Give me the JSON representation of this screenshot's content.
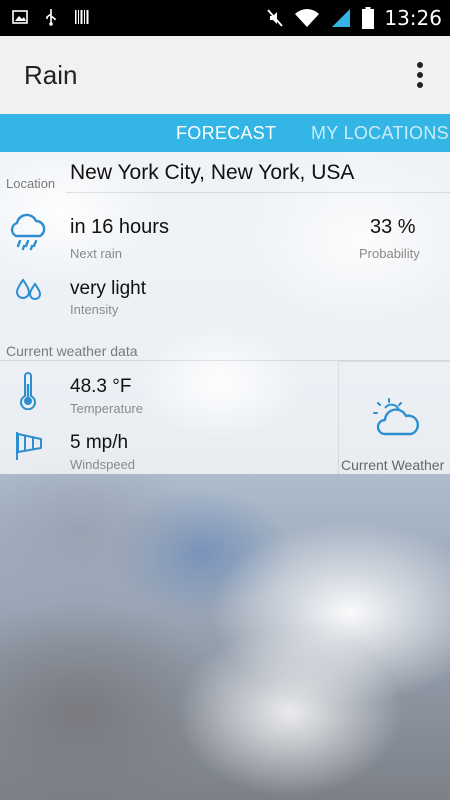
{
  "status_bar": {
    "time": "13:26",
    "icons": [
      "image-icon",
      "usb-icon",
      "barcode-icon",
      "mute-icon",
      "wifi-icon",
      "signal-icon",
      "battery-icon"
    ]
  },
  "app_bar": {
    "title": "Rain",
    "menu_icon": "overflow-menu-icon"
  },
  "tabs": [
    {
      "label": "FORECAST",
      "active": true
    },
    {
      "label": "MY LOCATIONS",
      "active": false
    }
  ],
  "location": {
    "label": "Location",
    "value": "New York City, New York, USA"
  },
  "next_rain": {
    "value": "in 16 hours",
    "label": "Next rain",
    "icon": "rain-cloud-icon"
  },
  "probability": {
    "value": "33 %",
    "label": "Probability"
  },
  "intensity": {
    "value": "very light",
    "label": "Intensity",
    "icon": "droplets-icon"
  },
  "current_section": {
    "label": "Current weather data"
  },
  "temperature": {
    "value": "48.3 °F",
    "label": "Temperature",
    "icon": "thermometer-icon"
  },
  "windspeed": {
    "value": "5 mp/h",
    "label": "Windspeed",
    "icon": "windsock-icon"
  },
  "current_weather": {
    "label": "Current Weather",
    "icon": "partly-cloudy-icon"
  },
  "colors": {
    "accent": "#33b5e5",
    "icon_blue": "#2e8fd0",
    "app_bar_bg": "#f1f1f1"
  }
}
